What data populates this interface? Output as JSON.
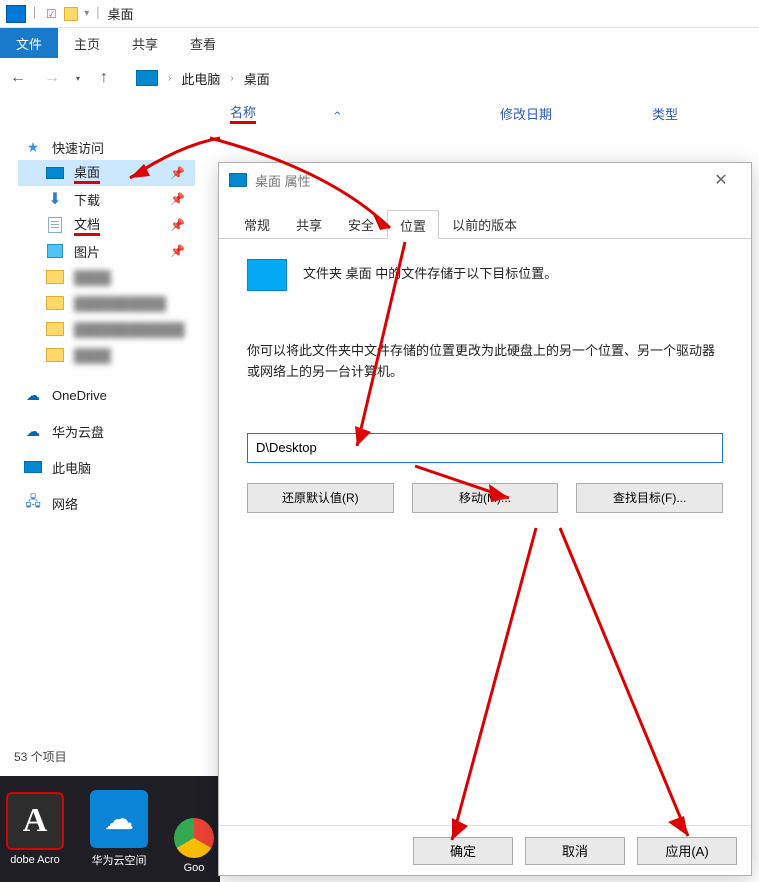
{
  "titlebar": {
    "title": "桌面"
  },
  "ribbon": {
    "file": "文件",
    "home": "主页",
    "share": "共享",
    "view": "查看"
  },
  "breadcrumb": {
    "pc": "此电脑",
    "desktop": "桌面"
  },
  "columns": {
    "name": "名称",
    "modified": "修改日期",
    "type": "类型"
  },
  "sidebar": {
    "quick": "快速访问",
    "desktop": "桌面",
    "downloads": "下载",
    "documents": "文档",
    "pictures": "图片",
    "onedrive": "OneDrive",
    "hwcloud": "华为云盘",
    "thispc": "此电脑",
    "network": "网络"
  },
  "status": {
    "items": "53 个项目"
  },
  "taskbar": {
    "adobe": "dobe Acro",
    "hw": "华为云空间",
    "chrome": "Goo"
  },
  "dialog": {
    "title": "桌面 属性",
    "tabs": {
      "general": "常规",
      "share": "共享",
      "security": "安全",
      "location": "位置",
      "prev": "以前的版本"
    },
    "line1": "文件夹 桌面 中的文件存储于以下目标位置。",
    "desc": "你可以将此文件夹中文件存储的位置更改为此硬盘上的另一个位置、另一个驱动器或网络上的另一台计算机。",
    "path": "D\\Desktop",
    "restore": "还原默认值(R)",
    "move": "移动(M)...",
    "find": "查找目标(F)...",
    "ok": "确定",
    "cancel": "取消",
    "apply": "应用(A)"
  }
}
